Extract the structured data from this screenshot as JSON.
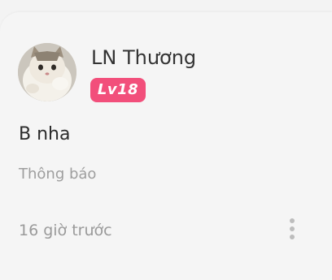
{
  "post": {
    "author_name": "LN Thương",
    "level_badge": "Lv18",
    "message": "B nha",
    "category": "Thông báo",
    "timestamp": "16 giờ trước"
  },
  "icons": {
    "avatar": "cat-avatar-image",
    "more": "vertical-ellipsis-icon"
  },
  "colors": {
    "badge": "#f24f7b",
    "background": "#f5f5f5",
    "primary_text": "#333333",
    "secondary_text": "#9e9e9e"
  }
}
